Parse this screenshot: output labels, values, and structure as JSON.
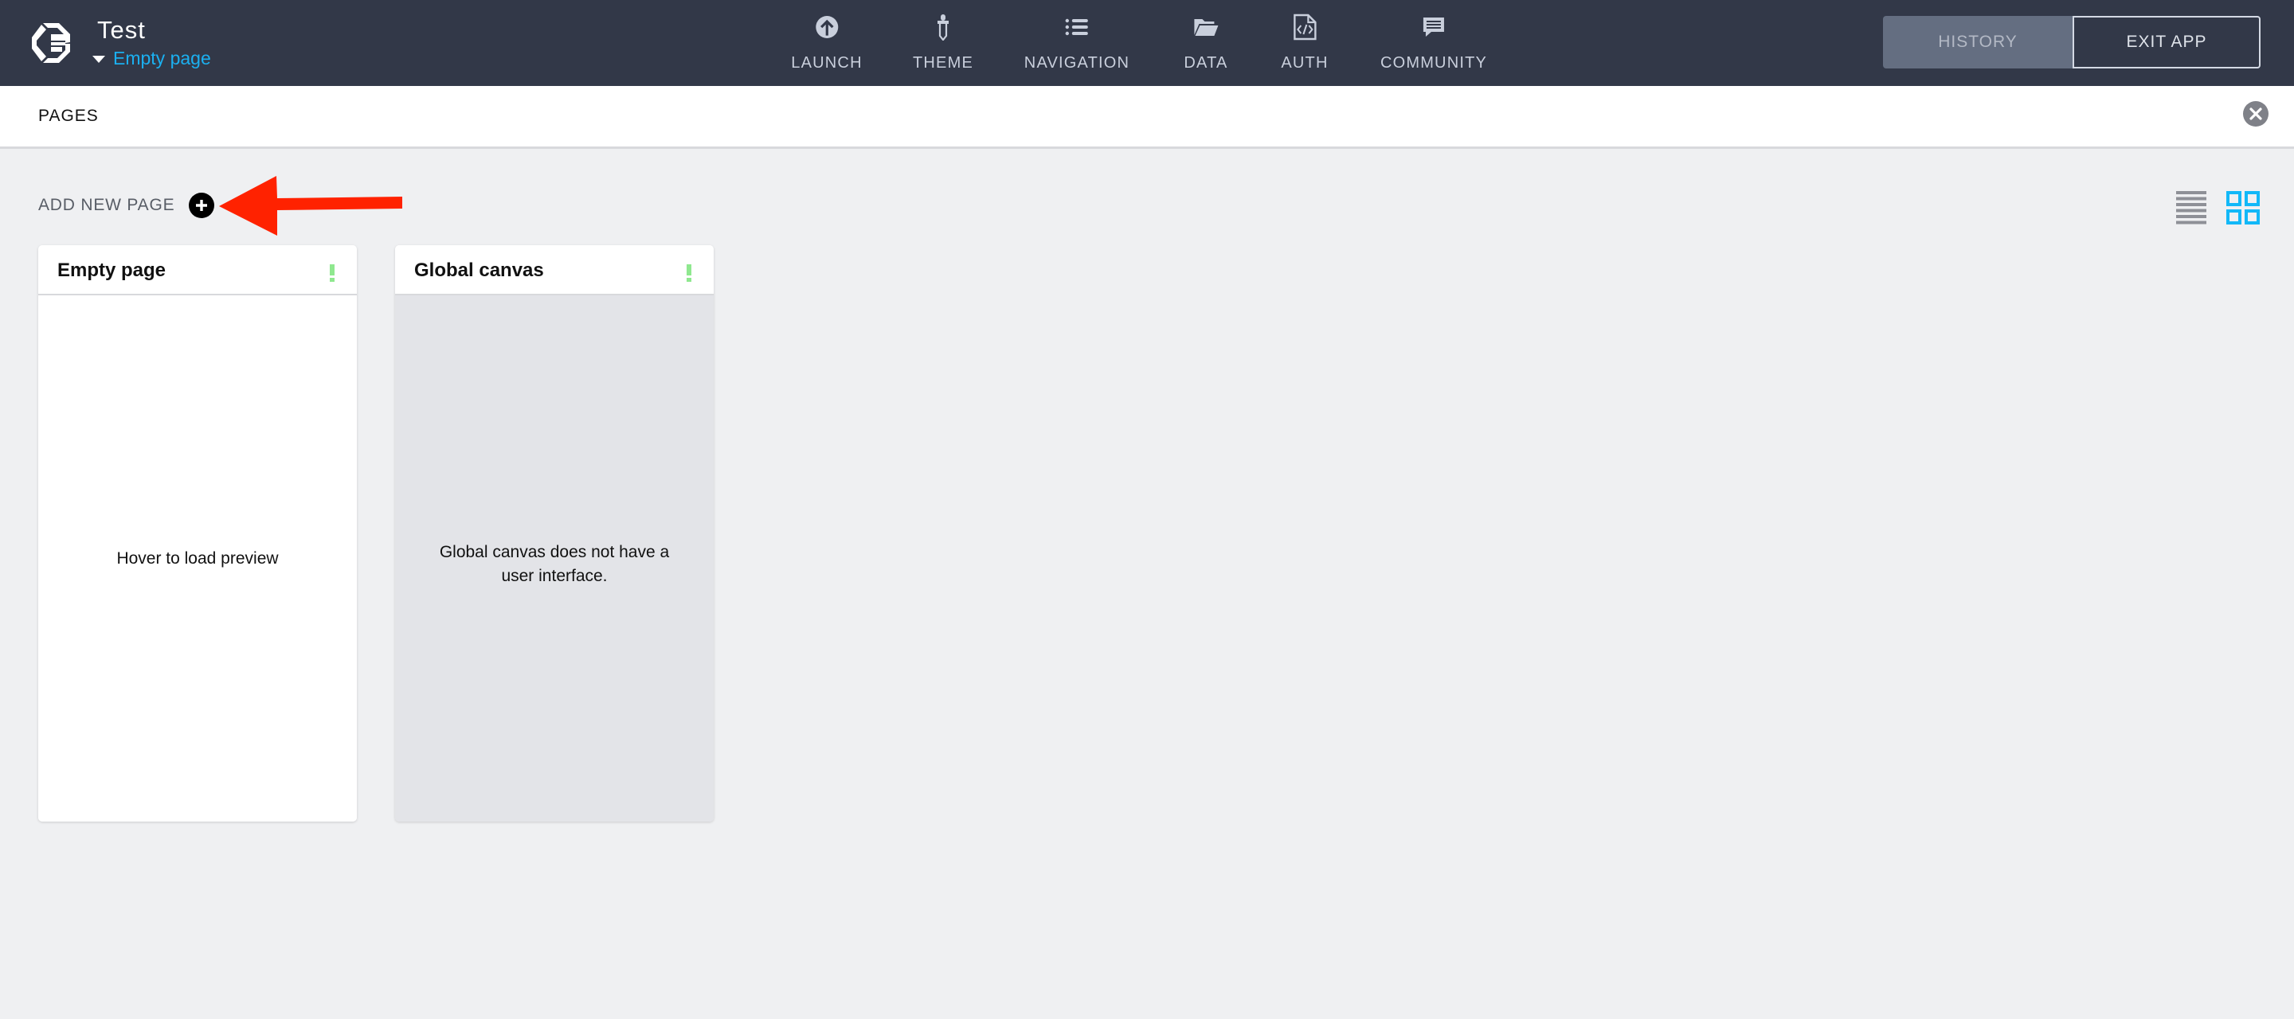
{
  "header": {
    "app_title": "Test",
    "current_page": "Empty page",
    "nav": [
      {
        "label": "LAUNCH",
        "icon": "launch-icon"
      },
      {
        "label": "THEME",
        "icon": "eyedropper-icon"
      },
      {
        "label": "NAVIGATION",
        "icon": "list-icon"
      },
      {
        "label": "DATA",
        "icon": "folder-icon"
      },
      {
        "label": "AUTH",
        "icon": "code-file-icon"
      },
      {
        "label": "COMMUNITY",
        "icon": "chat-icon"
      }
    ],
    "history_label": "HISTORY",
    "exit_label": "EXIT APP"
  },
  "pages_panel": {
    "title": "PAGES",
    "add_new_page_label": "ADD NEW PAGE",
    "active_view": "grid",
    "cards": [
      {
        "title": "Empty page",
        "body": "Hover to load preview",
        "status": "warning"
      },
      {
        "title": "Global canvas",
        "body": "Global canvas does not have a user interface.",
        "status": "warning"
      }
    ]
  },
  "colors": {
    "header_bg": "#323848",
    "accent": "#1bb0f0",
    "warning_green": "#8fe88f",
    "annotation_arrow": "#ff2200"
  }
}
